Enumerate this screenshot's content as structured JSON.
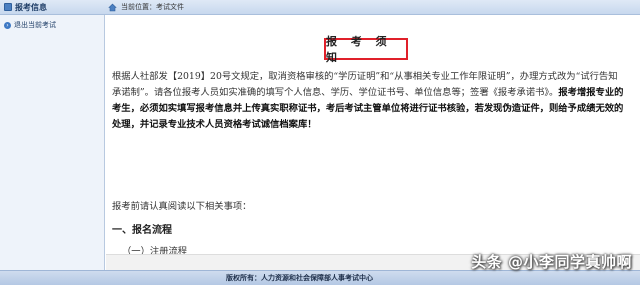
{
  "sidebar": {
    "title": "报考信息",
    "items": [
      {
        "label": "退出当前考试"
      }
    ]
  },
  "breadcrumb": {
    "prefix": "当前位置：",
    "current": "考试文件"
  },
  "doc": {
    "heading": "报 考 须 知",
    "para_normal": "根据人社部发【2019】20号文规定，取消资格审核的“学历证明”和“从事相关专业工作年限证明”，办理方式改为“试行告知承诺制”。请各位报考人员如实准确的填写个人信息、学历、学位证书号、单位信息等；签署《报考承诺书》。",
    "para_bold": "报考增报专业的考生，必须如实填写报考信息并上传真实职称证书，考后考试主管单位将进行证书核验，若发现伪造证件，则给予成绩无效的处理，并记录专业技术人员资格考试诚信档案库！",
    "note": "报考前请认真阅读以下相关事项：",
    "section1": "一、报名流程",
    "section1_sub": "（一）注册流程"
  },
  "footer": {
    "text": "版权所有：人力资源和社会保障部人事考试中心"
  },
  "watermark": {
    "text": "头条 @小李同学真帅啊"
  },
  "colors": {
    "highlight_border": "#e0202a",
    "header_bg": "#dfe9f6",
    "sidebar_bg": "#eef3fa"
  }
}
